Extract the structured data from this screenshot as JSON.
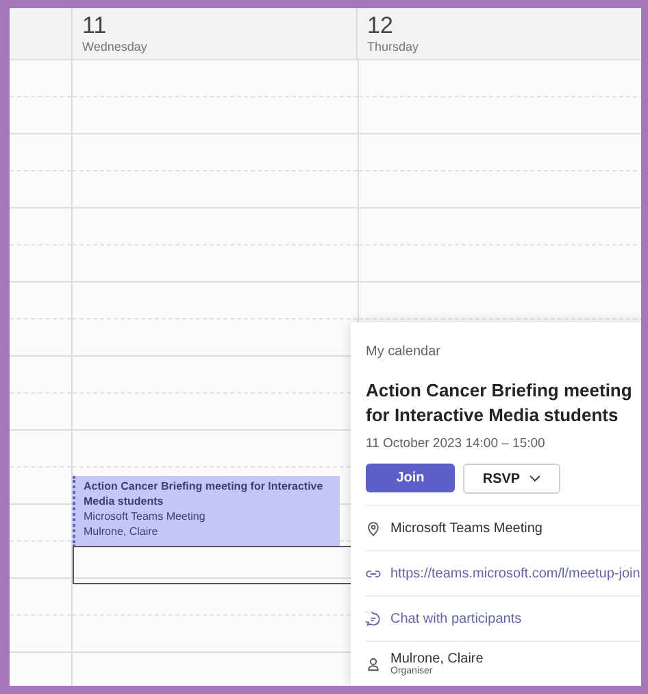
{
  "days": [
    {
      "number": "11",
      "weekday": "Wednesday",
      "events": [
        {
          "title": "Action Cancer Briefing meeting for Interactive Media students",
          "location": "Microsoft Teams Meeting",
          "organiser": "Mulrone, Claire",
          "selected": true
        }
      ]
    },
    {
      "number": "12",
      "weekday": "Thursday"
    }
  ],
  "popup": {
    "calendar": "My calendar",
    "title": "Action Cancer Briefing meeting for Interactive Media students",
    "when": "11 October 2023 14:00 – 15:00",
    "join": "Join",
    "rsvp": "RSVP",
    "details": [
      {
        "kind": "location",
        "text": "Microsoft Teams Meeting"
      },
      {
        "kind": "link",
        "text": "https://teams.microsoft.com/l/meetup-join"
      },
      {
        "kind": "chat",
        "text": "Chat with participants"
      },
      {
        "kind": "person",
        "text": "Mulrone, Claire",
        "role": "Organiser"
      }
    ]
  }
}
